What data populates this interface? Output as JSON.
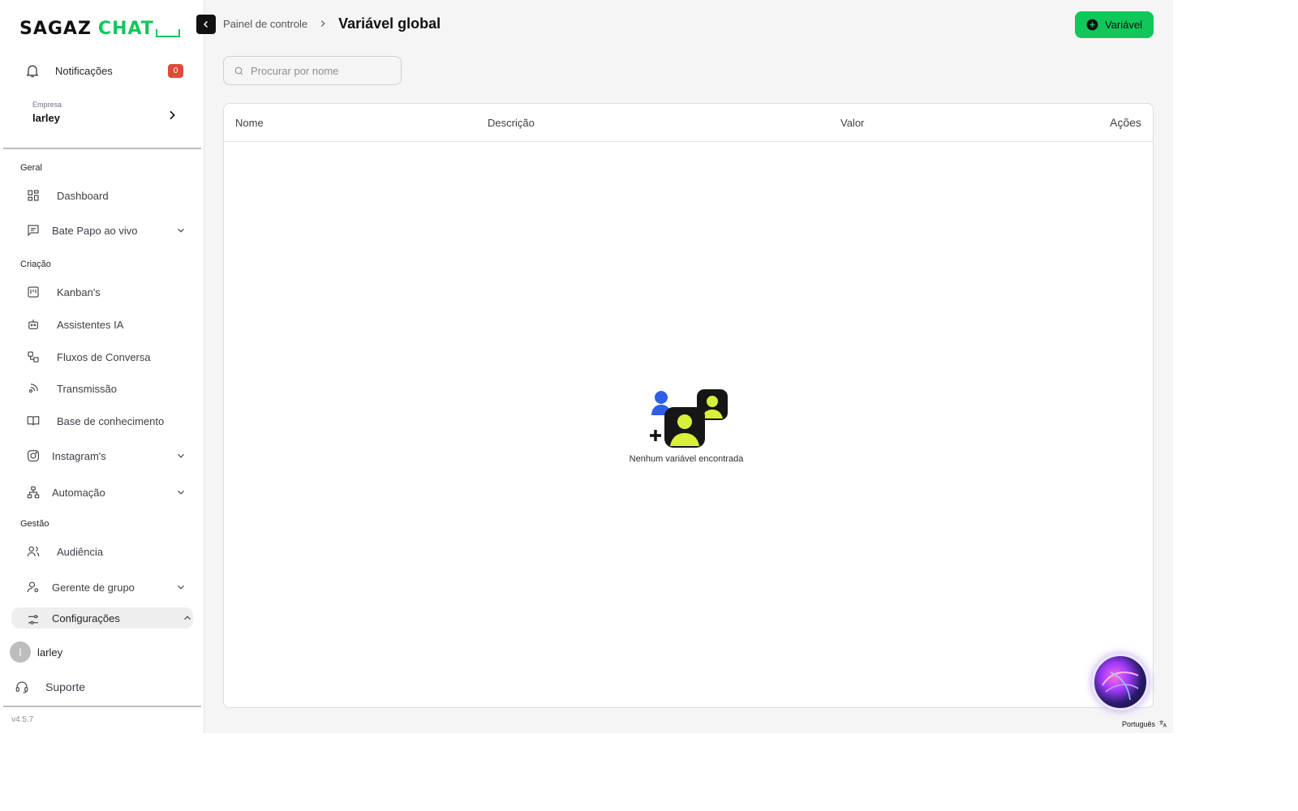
{
  "brand": {
    "part1": "SAGAZ",
    "part2": "CHAT"
  },
  "sidebar": {
    "notifications": {
      "label": "Notificações",
      "count": "0"
    },
    "company": {
      "caption": "Empresa",
      "name": "larley"
    },
    "sections": {
      "geral": "Geral",
      "criacao": "Criação",
      "gestao": "Gestão"
    },
    "items": {
      "dashboard": "Dashboard",
      "livechat": "Bate Papo ao vivo",
      "kanban": "Kanban's",
      "assistants": "Assistentes IA",
      "flows": "Fluxos de Conversa",
      "broadcast": "Transmissão",
      "knowledge": "Base de conhecimento",
      "instagram": "Instagram's",
      "automation": "Automação",
      "audience": "Audiência",
      "groups": "Gerente de grupo",
      "settings": "Configurações"
    },
    "user": {
      "initial": "l",
      "name": "larley"
    },
    "support": "Suporte",
    "version": "v4.5.7"
  },
  "header": {
    "breadcrumb_root": "Painel de controle",
    "title": "Variável global",
    "add_button": "Variável"
  },
  "search": {
    "placeholder": "Procurar por nome",
    "value": ""
  },
  "table": {
    "columns": [
      "Nome",
      "Descrição",
      "Valor",
      "Ações"
    ],
    "rows": [],
    "empty_message": "Nenhum variável encontrada"
  },
  "footer": {
    "language": "Português"
  },
  "colors": {
    "accent": "#12c75a",
    "badge": "#e04a3b",
    "dark": "#111111"
  },
  "icons": {
    "notifications": "bell-icon",
    "dashboard": "grid-icon",
    "livechat": "message-icon",
    "kanban": "kanban-icon",
    "assistants": "robot-icon",
    "flows": "flow-icon",
    "broadcast": "broadcast-icon",
    "knowledge": "book-icon",
    "instagram": "instagram-icon",
    "automation": "sitemap-icon",
    "audience": "users-icon",
    "groups": "user-gear-icon",
    "settings": "sliders-icon",
    "support": "headset-icon",
    "search": "search-icon",
    "add": "plus-circle-icon",
    "language": "translate-icon"
  }
}
